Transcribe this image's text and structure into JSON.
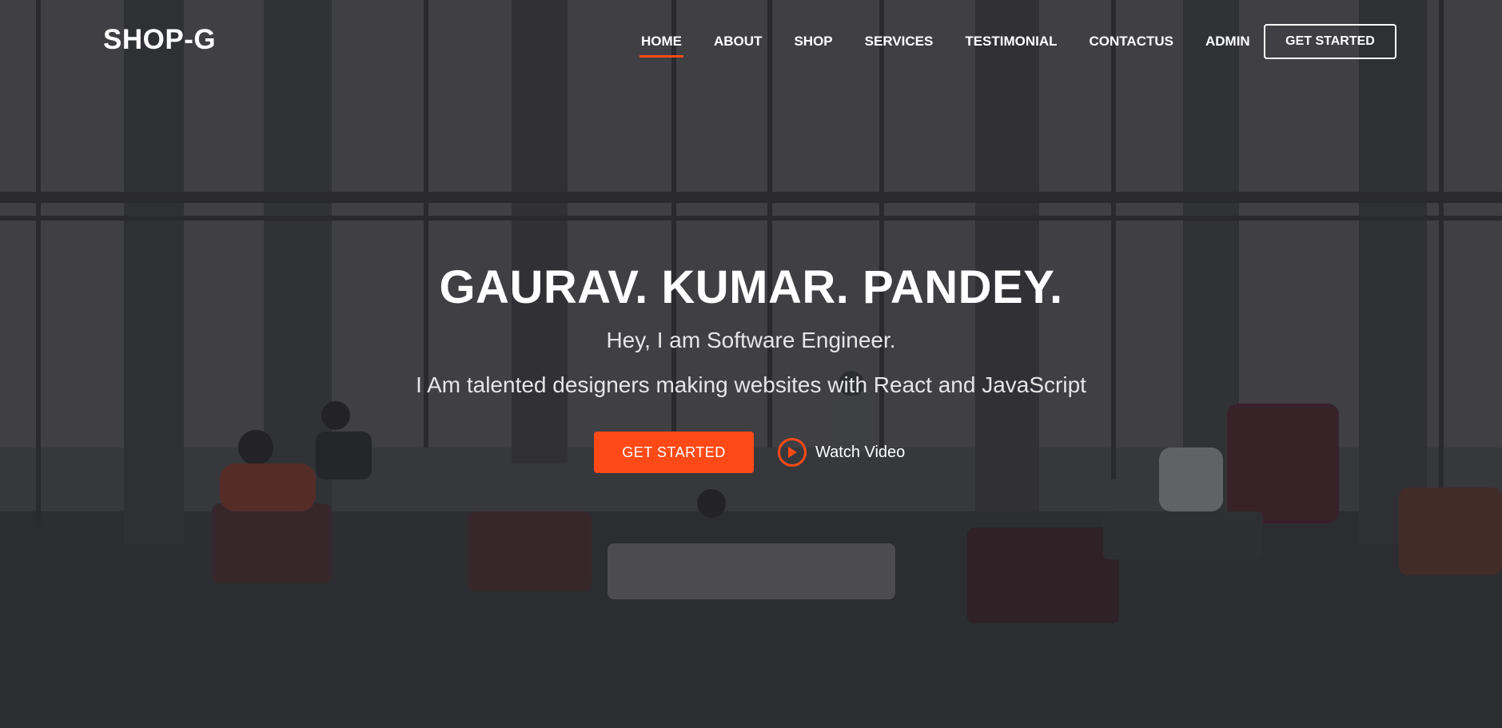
{
  "header": {
    "logo": "SHOP-G",
    "nav": [
      {
        "label": "HOME",
        "active": true
      },
      {
        "label": "ABOUT",
        "active": false
      },
      {
        "label": "SHOP",
        "active": false
      },
      {
        "label": "SERVICES",
        "active": false
      },
      {
        "label": "TESTIMONIAL",
        "active": false
      },
      {
        "label": "CONTACTUS",
        "active": false
      },
      {
        "label": "ADMIN",
        "active": false
      }
    ],
    "cta_label": "GET STARTED"
  },
  "hero": {
    "title": "GAURAV. KUMAR. PANDEY.",
    "subtitle": "Hey, I am Software Engineer.",
    "description": "I Am talented designers making websites with React and JavaScript",
    "primary_button": "GET STARTED",
    "video_label": "Watch Video",
    "video_icon": "play-icon"
  },
  "colors": {
    "accent": "#ff4a17",
    "text": "#ffffff",
    "overlay": "#141418"
  }
}
